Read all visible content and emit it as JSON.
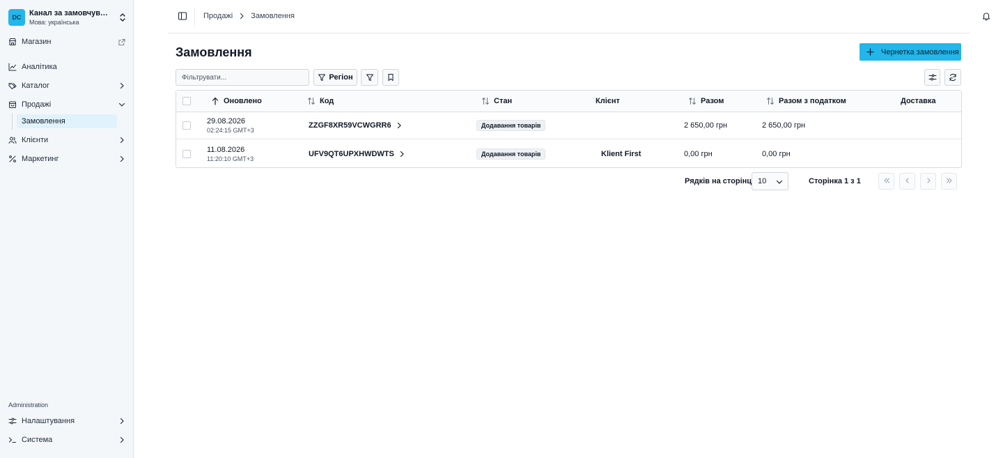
{
  "sidebar": {
    "channel": {
      "initials": "DC",
      "name": "Канал за замовчуван...",
      "language": "Мова: українська"
    },
    "store_link": "Магазин",
    "items": [
      {
        "label": "Аналітика"
      },
      {
        "label": "Каталог"
      },
      {
        "label": "Продажі"
      },
      {
        "label": "Замовлення"
      },
      {
        "label": "Клієнти"
      },
      {
        "label": "Маркетинг"
      }
    ],
    "admin_section": "Administration",
    "admin_items": [
      {
        "label": "Налаштування"
      },
      {
        "label": "Система"
      }
    ]
  },
  "header": {
    "breadcrumb": [
      "Продажі",
      "Замовлення"
    ]
  },
  "page": {
    "title": "Замовлення",
    "draft_button": "Чернетка замовлення",
    "filter_placeholder": "Фільтрувати...",
    "region_button": "Регіон"
  },
  "table": {
    "columns": [
      "Оновлено",
      "Код",
      "Стан",
      "Клієнт",
      "Разом",
      "Разом з податком",
      "Доставка"
    ],
    "rows": [
      {
        "date": "29.08.2026",
        "time": "02:24:15 GMT+3",
        "code": "ZZGF8XR59VCWGRR6",
        "state": "Додавання товарів",
        "customer": "",
        "total": "2 650,00 грн",
        "total_tax": "2 650,00 грн",
        "shipping": ""
      },
      {
        "date": "11.08.2026",
        "time": "11:20:10 GMT+3",
        "code": "UFV9QT6UPXHWDWTS",
        "state": "Додавання товарів",
        "customer": "Klient First",
        "total": "0,00 грн",
        "total_tax": "0,00 грн",
        "shipping": ""
      }
    ]
  },
  "pagination": {
    "rows_per_page_label": "Рядків на сторінці",
    "rows_per_page_value": "10",
    "page_info": "Сторінка 1 з 1"
  },
  "colors": {
    "accent": "#22b6ea",
    "active_nav_bg": "#e0f2fb"
  }
}
